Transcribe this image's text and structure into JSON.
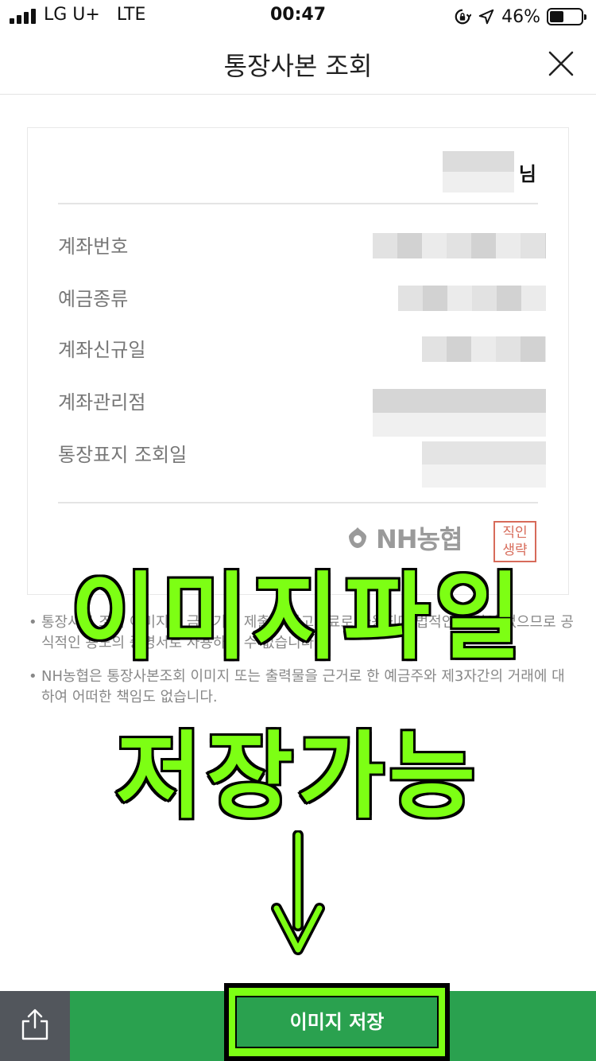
{
  "status_bar": {
    "carrier": "LG U+   LTE",
    "time": "00:47",
    "battery_percent": "46%",
    "battery_level": 0.46,
    "icons": [
      "signal-icon",
      "rotation-lock-icon",
      "location-arrow-icon",
      "battery-icon"
    ]
  },
  "header": {
    "title": "통장사본 조회",
    "close_icon": "close-icon"
  },
  "card": {
    "honorific": "님",
    "rows": [
      {
        "label": "계좌번호"
      },
      {
        "label": "예금종류"
      },
      {
        "label": "계좌신규일"
      },
      {
        "label": "계좌관리점"
      },
      {
        "label": "통장표지 조회일"
      }
    ],
    "brand": "NH농협",
    "seal_text": "직인 생략"
  },
  "notes": [
    "통장사본 조회 이미지는 금융기관 제출용 참고자료로 사용되며 법적인 효력이 없으므로 공식적인 용도의 증명서로 사용하실 수 없습니다.",
    "NH농협은 통장사본조회 이미지 또는 출력물을 근거로 한 예금주와 제3자간의 거래에 대하여 어떠한 책임도 없습니다."
  ],
  "overlay": {
    "line1": "이미지파일",
    "line2": "저장가능"
  },
  "bottom_bar": {
    "share_icon": "share-icon",
    "save_label": "이미지 저장"
  },
  "colors": {
    "primary_green": "#2aa14f",
    "highlight_green": "#7dff14",
    "share_bg": "#52565c",
    "seal_red": "#d76b5a"
  }
}
